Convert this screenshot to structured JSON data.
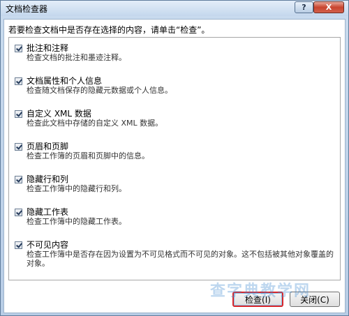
{
  "window": {
    "title": "文档检查器",
    "help_glyph": "?",
    "close_glyph": "X"
  },
  "instruction": "若要检查文档中是否存在选择的内容，请单击“检查”。",
  "items": [
    {
      "title": "批注和注释",
      "desc": "检查文档的批注和墨迹注释。",
      "checked": true
    },
    {
      "title": "文档属性和个人信息",
      "desc": "检查随文档保存的隐藏元数据或个人信息。",
      "checked": true
    },
    {
      "title": "自定义 XML 数据",
      "desc": "检查此文档中存储的自定义 XML 数据。",
      "checked": true
    },
    {
      "title": "页眉和页脚",
      "desc": "检查工作簿的页眉和页脚中的信息。",
      "checked": true
    },
    {
      "title": "隐藏行和列",
      "desc": "检查工作簿中的隐藏行和列。",
      "checked": true
    },
    {
      "title": "隐藏工作表",
      "desc": "检查工作簿中的隐藏工作表。",
      "checked": true
    },
    {
      "title": "不可见内容",
      "desc": "检查工作簿中是否存在因为设置为不可见格式而不可见的对象。这不包括被其他对象覆盖的对象。",
      "checked": true
    }
  ],
  "buttons": {
    "inspect": "检查(I)",
    "close": "关闭(C)"
  },
  "watermark": "查字典教学网"
}
